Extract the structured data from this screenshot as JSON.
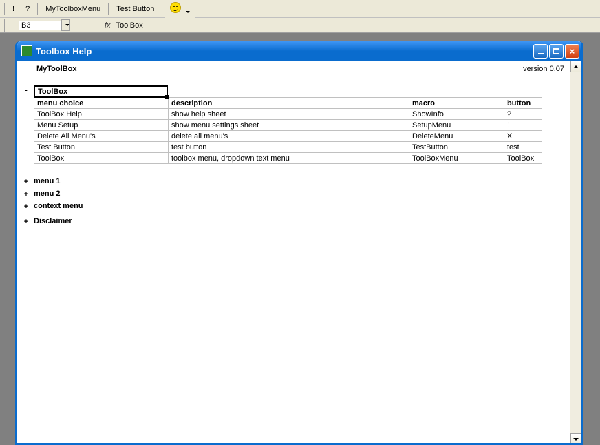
{
  "toolbar": {
    "btn_exclaim": "!",
    "btn_question": "?",
    "btn_mytoolbox": "MyToolboxMenu",
    "btn_test": "Test Button"
  },
  "name_box": "B3",
  "formula": "ToolBox",
  "window": {
    "title": "Toolbox Help"
  },
  "doc": {
    "title": "MyToolBox",
    "version": "version 0.07",
    "selected_cell": "ToolBox"
  },
  "headers": {
    "menu_choice": "menu choice",
    "description": "description",
    "macro": "macro",
    "button": "button"
  },
  "rows": [
    {
      "menu": "ToolBox Help",
      "desc": "show help sheet",
      "macro": "ShowInfo",
      "button": "?"
    },
    {
      "menu": "Menu Setup",
      "desc": "show menu settings sheet",
      "macro": "SetupMenu",
      "button": "!"
    },
    {
      "menu": "Delete All Menu's",
      "desc": "delete all menu's",
      "macro": "DeleteMenu",
      "button": "X"
    },
    {
      "menu": "Test Button",
      "desc": "test button",
      "macro": "TestButton",
      "button": "test"
    },
    {
      "menu": "ToolBox",
      "desc": "toolbox menu, dropdown text menu",
      "macro": "ToolBoxMenu",
      "button": "ToolBox"
    }
  ],
  "groups": [
    {
      "sym": "+",
      "label": "menu  1"
    },
    {
      "sym": "+",
      "label": "menu 2"
    },
    {
      "sym": "+",
      "label": "context menu"
    },
    {
      "sym": "+",
      "label": "Disclaimer"
    }
  ]
}
